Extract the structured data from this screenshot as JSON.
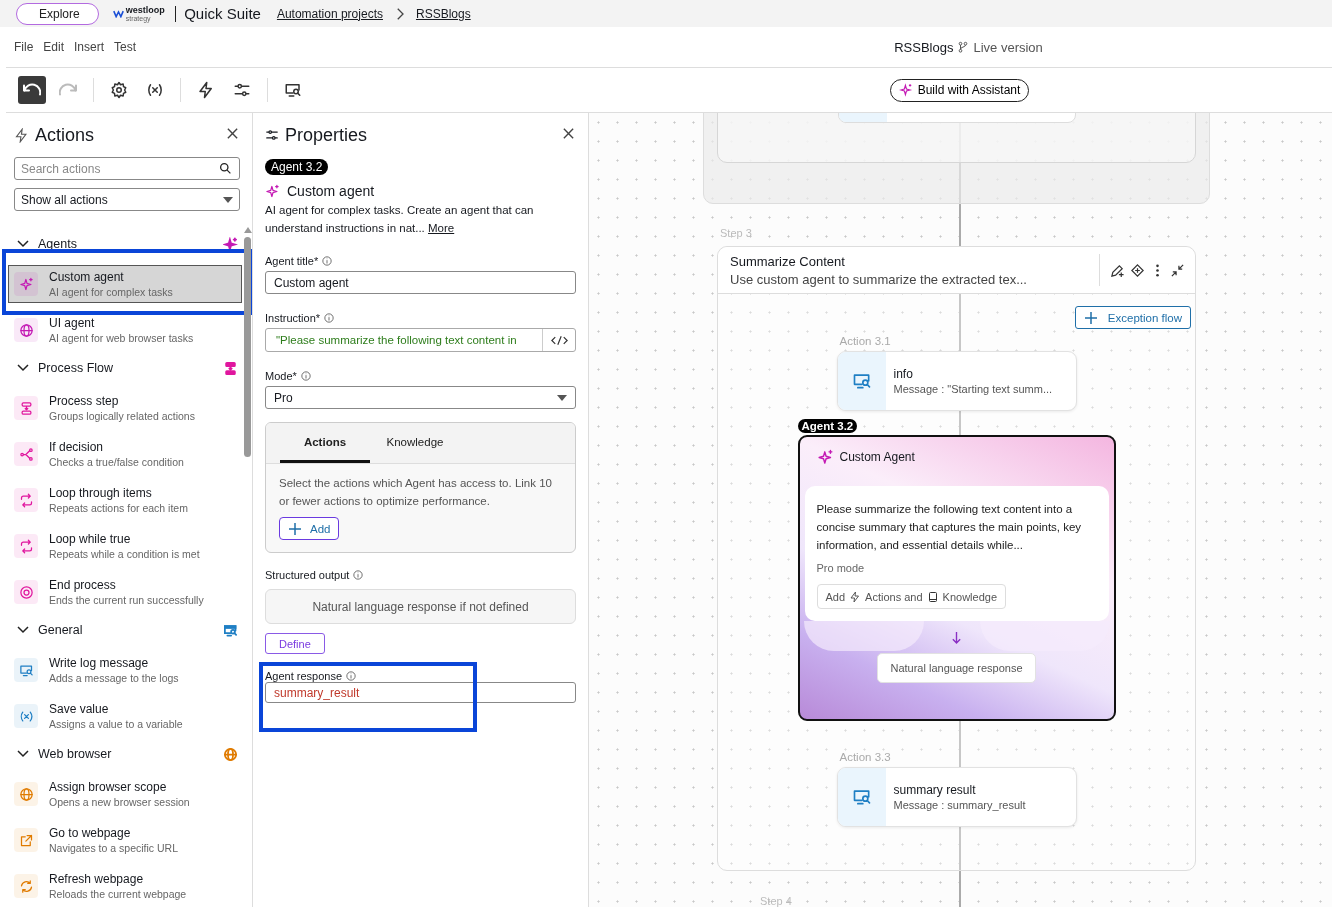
{
  "top_bar": {
    "explore_button": "Explore",
    "logo": "westloop",
    "logo_sub": "strategy",
    "product": "Quick Suite",
    "breadcrumbs": [
      "Automation projects",
      "RSSBlogs"
    ]
  },
  "menu": [
    "File",
    "Edit",
    "Insert",
    "Test"
  ],
  "document": {
    "name": "RSSBlogs",
    "version": "Live version"
  },
  "toolbar": [
    {
      "tools": [
        {
          "kind": "undo",
          "active": true,
          "disabled": false
        },
        {
          "kind": "redo",
          "active": false,
          "disabled": true
        }
      ]
    },
    {
      "tools": [
        {
          "kind": "settings"
        },
        {
          "kind": "variable"
        }
      ]
    },
    {
      "tools": [
        {
          "kind": "bolt"
        },
        {
          "kind": "sliders"
        }
      ]
    },
    {
      "tools": [
        {
          "kind": "log"
        }
      ]
    }
  ],
  "assistant_button": "Build with Assistant",
  "actions_panel": {
    "title": "Actions",
    "search_placeholder": "Search actions",
    "filter": "Show all actions",
    "groups": [
      {
        "name": "Agents",
        "color": "#c41ab4",
        "expanded": true,
        "items": [
          {
            "title": "Custom agent",
            "subtitle": "AI agent for complex tasks",
            "selected": true,
            "highlighted": true
          },
          {
            "title": "UI agent",
            "subtitle": "AI agent for web browser tasks",
            "selected": false,
            "highlighted": false
          }
        ]
      },
      {
        "name": "Process Flow",
        "color": "#e0169e",
        "expanded": true,
        "items": [
          {
            "title": "Process step",
            "subtitle": "Groups logically related actions",
            "selected": false,
            "highlighted": false
          },
          {
            "title": "If decision",
            "subtitle": "Checks a true/false condition",
            "selected": false,
            "highlighted": false
          },
          {
            "title": "Loop through items",
            "subtitle": "Repeats actions for each item",
            "selected": false,
            "highlighted": false
          },
          {
            "title": "Loop while true",
            "subtitle": "Repeats while a condition is met",
            "selected": false,
            "highlighted": false
          },
          {
            "title": "End process",
            "subtitle": "Ends the current run successfully",
            "selected": false,
            "highlighted": false
          }
        ]
      },
      {
        "name": "General",
        "color": "#1f7fc4",
        "expanded": true,
        "items": [
          {
            "title": "Write log message",
            "subtitle": "Adds a message to the logs",
            "selected": false,
            "highlighted": false
          },
          {
            "title": "Save value",
            "subtitle": "Assigns a value to a variable",
            "selected": false,
            "highlighted": false
          }
        ]
      },
      {
        "name": "Web browser",
        "color": "#e07b00",
        "expanded": true,
        "items": [
          {
            "title": "Assign browser scope",
            "subtitle": "Opens a new browser session",
            "selected": false,
            "highlighted": false
          },
          {
            "title": "Go to webpage",
            "subtitle": "Navigates to a specific URL",
            "selected": false,
            "highlighted": false
          },
          {
            "title": "Refresh webpage",
            "subtitle": "Reloads the current webpage",
            "selected": false,
            "highlighted": false
          }
        ]
      }
    ]
  },
  "properties_panel": {
    "title": "Properties",
    "badge": "Agent 3.2",
    "agent_name": "Custom agent",
    "description": "AI agent for complex tasks. Create an agent that can understand instructions in nat...",
    "more_link": "More",
    "fields": [
      {
        "label": "Agent title*",
        "kind": "text",
        "value": "Custom agent"
      },
      {
        "label": "Instruction*",
        "kind": "code",
        "value": "\"Please summarize the following text content in"
      },
      {
        "label": "Mode*",
        "kind": "select",
        "value": "Pro"
      }
    ],
    "tabs": [
      {
        "label": "Actions",
        "selected": true
      },
      {
        "label": "Knowledge",
        "selected": false
      }
    ],
    "tab_text": "Select the actions which Agent has access to. Link 10 or fewer actions to optimize performance.",
    "add_button": "Add",
    "structured_output": {
      "label": "Structured output",
      "placeholder": "Natural language response if not defined",
      "button": "Define"
    },
    "agent_response": {
      "label": "Agent response",
      "value": "summary_result",
      "highlighted": true
    }
  },
  "canvas": {
    "step": {
      "label": "Step 3",
      "title": "Summarize Content",
      "description": "Use custom agent to summarize the extracted tex...",
      "exception_button": "Exception flow",
      "nodes": [
        {
          "kind": "log",
          "label": "Action 3.1",
          "title": "info",
          "message": "Message : \"Starting text summ..."
        },
        {
          "kind": "agent",
          "badge": "Agent 3.2",
          "title": "Custom Agent",
          "instruction": "Please summarize the following text content into a concise summary that captures the main points, key information, and essential details while...",
          "mode": "Pro mode",
          "add_prefix": "Add",
          "actions_label": "Actions and",
          "knowledge_label": "Knowledge",
          "output": "Natural language response",
          "selected": true
        },
        {
          "kind": "log",
          "label": "Action 3.3",
          "title": "summary result",
          "message": "Message : summary_result"
        }
      ]
    },
    "next_step_label": "Step 4"
  }
}
